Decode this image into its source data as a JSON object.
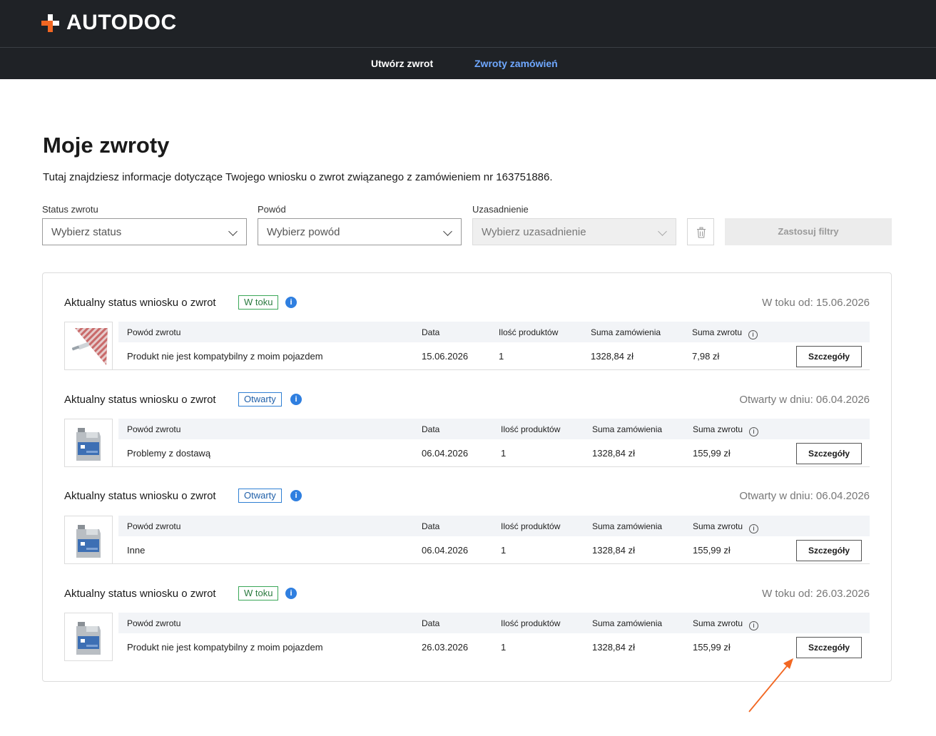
{
  "header": {
    "logo_text": "AUTODOC",
    "nav": [
      {
        "label": "Utwórz zwrot",
        "active": false
      },
      {
        "label": "Zwroty zamówień",
        "active": true
      }
    ]
  },
  "page": {
    "title": "Moje zwroty",
    "description": "Tutaj znajdziesz informacje dotyczące Twojego wniosku o zwrot związanego z zamówieniem nr 163751886."
  },
  "filters": {
    "status": {
      "label": "Status zwrotu",
      "placeholder": "Wybierz status"
    },
    "reason": {
      "label": "Powód",
      "placeholder": "Wybierz powód"
    },
    "justification": {
      "label": "Uzasadnienie",
      "placeholder": "Wybierz uzasadnienie"
    },
    "apply_label": "Zastosuj filtry"
  },
  "returns": [
    {
      "header_label": "Aktualny status wniosku o zwrot",
      "status": "W toku",
      "status_color": "green",
      "status_date": "W toku od: 15.06.2026",
      "product_icon": "wiper-blade-product",
      "columns": [
        "Powód zwrotu",
        "Data",
        "Ilość produktów",
        "Suma zamówienia",
        "Suma zwrotu"
      ],
      "reason": "Produkt nie jest kompatybilny z moim pojazdem",
      "date": "15.06.2026",
      "quantity": "1",
      "order_sum": "1328,84 zł",
      "refund_sum": "7,98 zł",
      "details_label": "Szczegóły"
    },
    {
      "header_label": "Aktualny status wniosku o zwrot",
      "status": "Otwarty",
      "status_color": "blue",
      "status_date": "Otwarty w dniu: 06.04.2026",
      "product_icon": "oil-canister-product",
      "columns": [
        "Powód zwrotu",
        "Data",
        "Ilość produktów",
        "Suma zamówienia",
        "Suma zwrotu"
      ],
      "reason": "Problemy z dostawą",
      "date": "06.04.2026",
      "quantity": "1",
      "order_sum": "1328,84 zł",
      "refund_sum": "155,99 zł",
      "details_label": "Szczegóły"
    },
    {
      "header_label": "Aktualny status wniosku o zwrot",
      "status": "Otwarty",
      "status_color": "blue",
      "status_date": "Otwarty w dniu: 06.04.2026",
      "product_icon": "oil-canister-product",
      "columns": [
        "Powód zwrotu",
        "Data",
        "Ilość produktów",
        "Suma zamówienia",
        "Suma zwrotu"
      ],
      "reason": "Inne",
      "date": "06.04.2026",
      "quantity": "1",
      "order_sum": "1328,84 zł",
      "refund_sum": "155,99 zł",
      "details_label": "Szczegóły"
    },
    {
      "header_label": "Aktualny status wniosku o zwrot",
      "status": "W toku",
      "status_color": "green",
      "status_date": "W toku od: 26.03.2026",
      "product_icon": "oil-canister-product",
      "columns": [
        "Powód zwrotu",
        "Data",
        "Ilość produktów",
        "Suma zamówienia",
        "Suma zwrotu"
      ],
      "reason": "Produkt nie jest kompatybilny z moim pojazdem",
      "date": "26.03.2026",
      "quantity": "1",
      "order_sum": "1328,84 zł",
      "refund_sum": "155,99 zł",
      "details_label": "Szczegóły"
    }
  ],
  "colors": {
    "header_bg": "#1f2226",
    "brand_orange": "#f26722",
    "nav_active": "#6fa8ff",
    "status_green": "#3aa757",
    "status_blue": "#2f7fd3",
    "info_blue": "#2f7fe0",
    "annotation_arrow": "#f26722"
  }
}
